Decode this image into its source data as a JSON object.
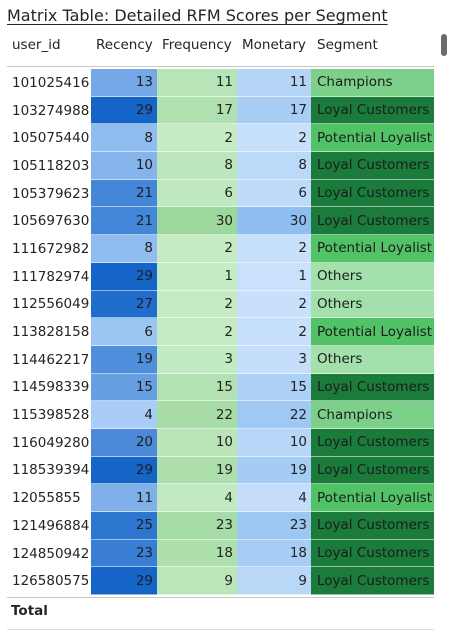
{
  "title": "Matrix Table: Detailed RFM Scores per Segment",
  "columns": {
    "user_id": "user_id",
    "recency": "Recency",
    "frequency": "Frequency",
    "monetary": "Monetary",
    "segment": "Segment"
  },
  "rows": [
    {
      "user_id": "101025416",
      "recency": "13",
      "frequency": "11",
      "monetary": "11",
      "segment": "Champions"
    },
    {
      "user_id": "103274988",
      "recency": "29",
      "frequency": "17",
      "monetary": "17",
      "segment": "Loyal Customers"
    },
    {
      "user_id": "105075440",
      "recency": "8",
      "frequency": "2",
      "monetary": "2",
      "segment": "Potential Loyalist"
    },
    {
      "user_id": "105118203",
      "recency": "10",
      "frequency": "8",
      "monetary": "8",
      "segment": "Loyal Customers"
    },
    {
      "user_id": "105379623",
      "recency": "21",
      "frequency": "6",
      "monetary": "6",
      "segment": "Loyal Customers"
    },
    {
      "user_id": "105697630",
      "recency": "21",
      "frequency": "30",
      "monetary": "30",
      "segment": "Loyal Customers"
    },
    {
      "user_id": "111672982",
      "recency": "8",
      "frequency": "2",
      "monetary": "2",
      "segment": "Potential Loyalist"
    },
    {
      "user_id": "111782974",
      "recency": "29",
      "frequency": "1",
      "monetary": "1",
      "segment": "Others"
    },
    {
      "user_id": "112556049",
      "recency": "27",
      "frequency": "2",
      "monetary": "2",
      "segment": "Others"
    },
    {
      "user_id": "113828158",
      "recency": "6",
      "frequency": "2",
      "monetary": "2",
      "segment": "Potential Loyalist"
    },
    {
      "user_id": "114462217",
      "recency": "19",
      "frequency": "3",
      "monetary": "3",
      "segment": "Others"
    },
    {
      "user_id": "114598339",
      "recency": "15",
      "frequency": "15",
      "monetary": "15",
      "segment": "Loyal Customers"
    },
    {
      "user_id": "115398528",
      "recency": "4",
      "frequency": "22",
      "monetary": "22",
      "segment": "Champions"
    },
    {
      "user_id": "116049280",
      "recency": "20",
      "frequency": "10",
      "monetary": "10",
      "segment": "Loyal Customers"
    },
    {
      "user_id": "118539394",
      "recency": "29",
      "frequency": "19",
      "monetary": "19",
      "segment": "Loyal Customers"
    },
    {
      "user_id": "12055855",
      "recency": "11",
      "frequency": "4",
      "monetary": "4",
      "segment": "Potential Loyalist"
    },
    {
      "user_id": "121496884",
      "recency": "25",
      "frequency": "23",
      "monetary": "23",
      "segment": "Loyal Customers"
    },
    {
      "user_id": "124850942",
      "recency": "23",
      "frequency": "18",
      "monetary": "18",
      "segment": "Loyal Customers"
    },
    {
      "user_id": "126580575",
      "recency": "29",
      "frequency": "9",
      "monetary": "9",
      "segment": "Loyal Customers"
    }
  ],
  "total_label": "Total",
  "colors": {
    "recency_low": "#a9cdf6",
    "recency_high": "#1565c9",
    "frequency_low": "#c6ecc6",
    "frequency_high": "#9cd79c",
    "monetary_low": "#c9e1fb",
    "monetary_high": "#8fbff0",
    "segment_champions": "#7dd08a",
    "segment_loyal_customers": "#1a7b3b",
    "segment_potential_loyalist": "#52c266",
    "segment_others": "#a3e0ac"
  }
}
